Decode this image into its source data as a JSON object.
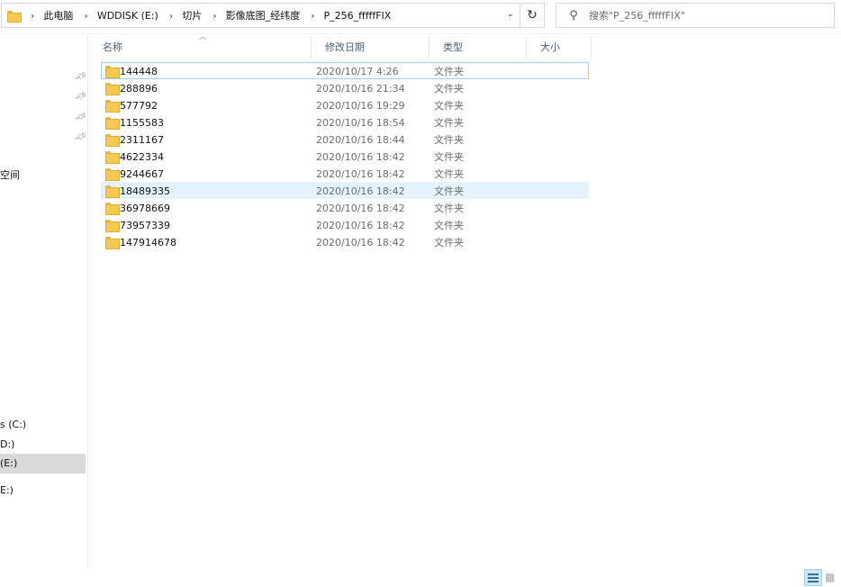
{
  "address_bar": {
    "crumbs": [
      "此电脑",
      "WDDISK (E:)",
      "切片",
      "影像底图_经纬度",
      "P_256_fffffFIX"
    ],
    "dropdown_icon": "chevron-down-icon"
  },
  "refresh_icon": "refresh-icon",
  "search": {
    "placeholder": "搜索\"P_256_fffffFIX\""
  },
  "nav": {
    "quick_access_tail": "空间",
    "drives": [
      "s (C:)",
      "D:)",
      "(E:)",
      "E:)"
    ]
  },
  "columns": {
    "name": "名称",
    "modified": "修改日期",
    "type": "类型",
    "size": "大小"
  },
  "files": [
    {
      "name": "144448",
      "modified": "2020/10/17 4:26",
      "type": "文件夹"
    },
    {
      "name": "288896",
      "modified": "2020/10/16 21:34",
      "type": "文件夹"
    },
    {
      "name": "577792",
      "modified": "2020/10/16 19:29",
      "type": "文件夹"
    },
    {
      "name": "1155583",
      "modified": "2020/10/16 18:54",
      "type": "文件夹"
    },
    {
      "name": "2311167",
      "modified": "2020/10/16 18:44",
      "type": "文件夹"
    },
    {
      "name": "4622334",
      "modified": "2020/10/16 18:42",
      "type": "文件夹"
    },
    {
      "name": "9244667",
      "modified": "2020/10/16 18:42",
      "type": "文件夹"
    },
    {
      "name": "18489335",
      "modified": "2020/10/16 18:42",
      "type": "文件夹"
    },
    {
      "name": "36978669",
      "modified": "2020/10/16 18:42",
      "type": "文件夹"
    },
    {
      "name": "73957339",
      "modified": "2020/10/16 18:42",
      "type": "文件夹"
    },
    {
      "name": "147914678",
      "modified": "2020/10/16 18:42",
      "type": "文件夹"
    }
  ],
  "colors": {
    "folder": "#f5c952",
    "hover_row": "#e5f3ff",
    "focus_border": "#99d1ff",
    "selected_drive": "#d9d9d9"
  }
}
